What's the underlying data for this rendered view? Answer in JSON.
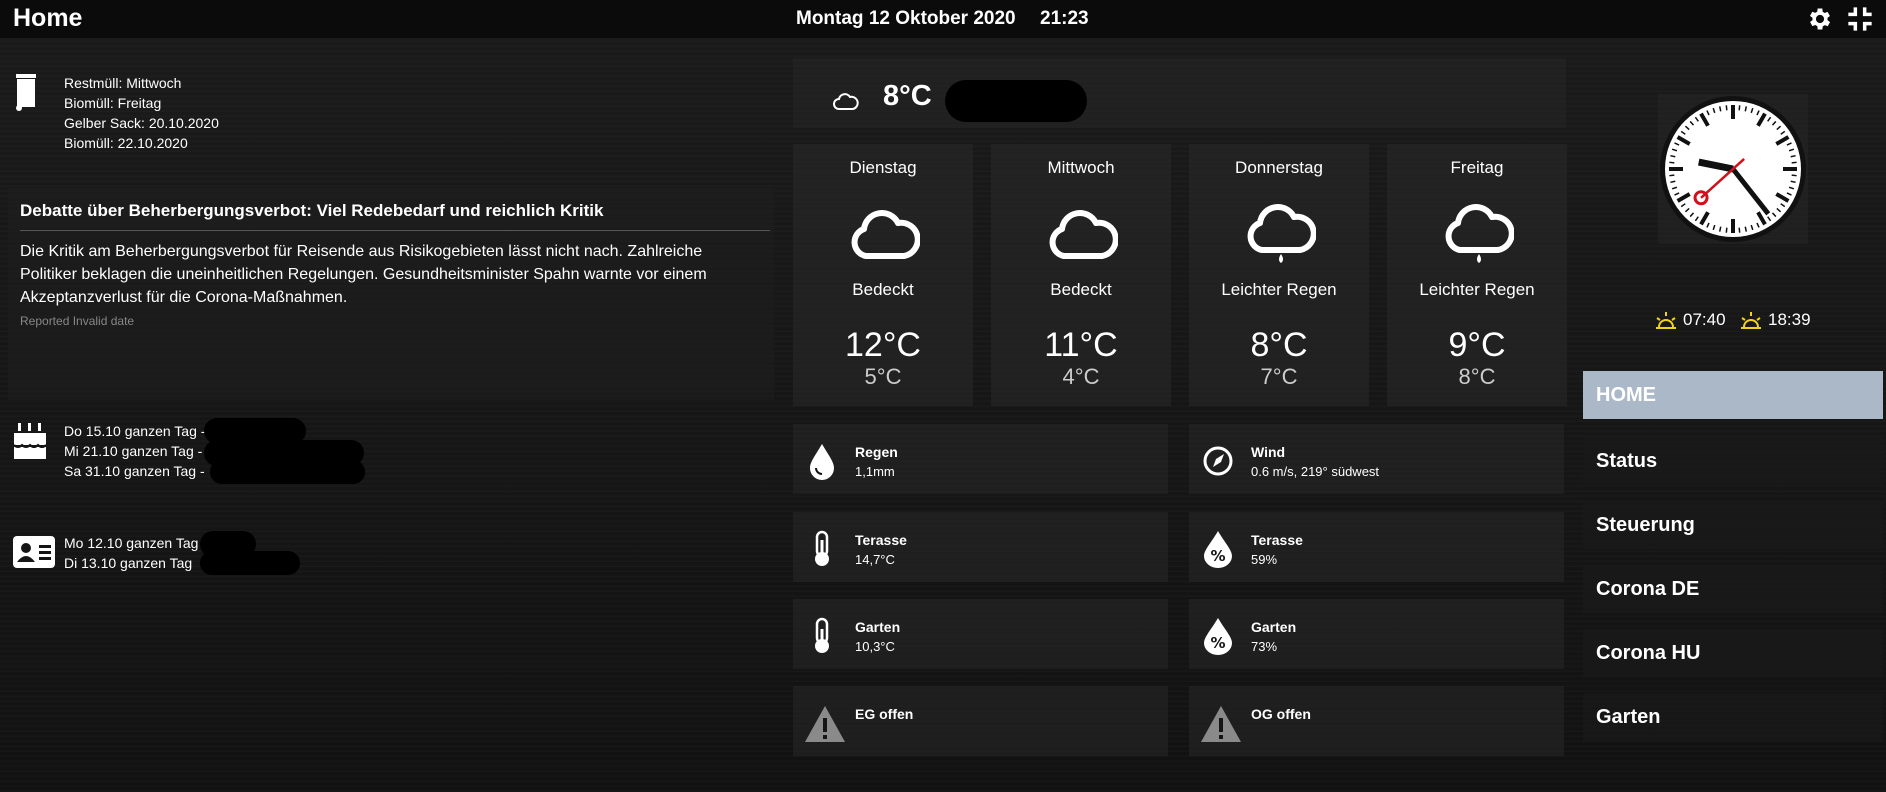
{
  "header": {
    "title": "Home",
    "date": "Montag 12 Oktober 2020",
    "time": "21:23",
    "settings_icon": "gear-icon",
    "fullscreen_icon": "compress-icon"
  },
  "trash": {
    "icon": "trash-bin-icon",
    "lines": [
      "Restmüll: Mittwoch",
      "Biomüll: Freitag",
      "Gelber Sack: 20.10.2020",
      "Biomüll: 22.10.2020"
    ]
  },
  "news": {
    "headline": "Debatte über Beherbergungsverbot: Viel Redebedarf und reichlich Kritik",
    "body": "Die Kritik am Beherbergungsverbot für Reisende aus Risikogebieten lässt nicht nach. Zahlreiche Politiker beklagen die uneinheitlichen Regelungen. Gesundheitsminister Spahn warnte vor einem Akzeptanzverlust für die Corona-Maßnahmen.",
    "reported": "Reported Invalid date"
  },
  "birthdays": {
    "icon": "birthday-cake-icon",
    "lines": [
      "Do 15.10 ganzen Tag -",
      "Mi 21.10 ganzen Tag -",
      "Sa 31.10 ganzen Tag -"
    ]
  },
  "contacts": {
    "icon": "id-card-icon",
    "lines": [
      "Mo 12.10 ganzen Tag",
      "Di 13.10 ganzen Tag"
    ]
  },
  "weather": {
    "current_temp": "8°C",
    "current_icon": "cloud-icon",
    "forecast": [
      {
        "day": "Dienstag",
        "condition": "Bedeckt",
        "high": "12°C",
        "low": "5°C",
        "icon": "cloud-icon"
      },
      {
        "day": "Mittwoch",
        "condition": "Bedeckt",
        "high": "11°C",
        "low": "4°C",
        "icon": "cloud-icon"
      },
      {
        "day": "Donnerstag",
        "condition": "Leichter Regen",
        "high": "8°C",
        "low": "7°C",
        "icon": "light-rain-icon"
      },
      {
        "day": "Freitag",
        "condition": "Leichter Regen",
        "high": "9°C",
        "low": "8°C",
        "icon": "light-rain-icon"
      }
    ]
  },
  "sensors": [
    {
      "name": "Regen",
      "value": "1,1mm",
      "icon": "water-drop-icon"
    },
    {
      "name": "Wind",
      "value": "0.6 m/s, 219° südwest",
      "icon": "compass-icon"
    },
    {
      "name": "Terasse",
      "value": "14,7°C",
      "icon": "thermometer-icon"
    },
    {
      "name": "Terasse",
      "value": "59%",
      "icon": "humidity-icon"
    },
    {
      "name": "Garten",
      "value": "10,3°C",
      "icon": "thermometer-icon"
    },
    {
      "name": "Garten",
      "value": "73%",
      "icon": "humidity-icon"
    },
    {
      "name": "EG offen",
      "value": "",
      "icon": "warning-icon"
    },
    {
      "name": "OG offen",
      "value": "",
      "icon": "warning-icon"
    }
  ],
  "sun": {
    "sunrise": "07:40",
    "sunset": "18:39",
    "sunrise_icon": "sunrise-icon",
    "sunset_icon": "sunset-icon"
  },
  "clock": {
    "hour": 9,
    "minute": 23,
    "second": 38
  },
  "menu": [
    {
      "label": "HOME",
      "active": true
    },
    {
      "label": "Status"
    },
    {
      "label": "Steuerung"
    },
    {
      "label": "Corona DE"
    },
    {
      "label": "Corona HU"
    },
    {
      "label": "Garten"
    }
  ],
  "colors": {
    "active_menu": "#aab8c8",
    "sun_icon": "#f2d31b",
    "clock_hand": "#d0101a"
  }
}
